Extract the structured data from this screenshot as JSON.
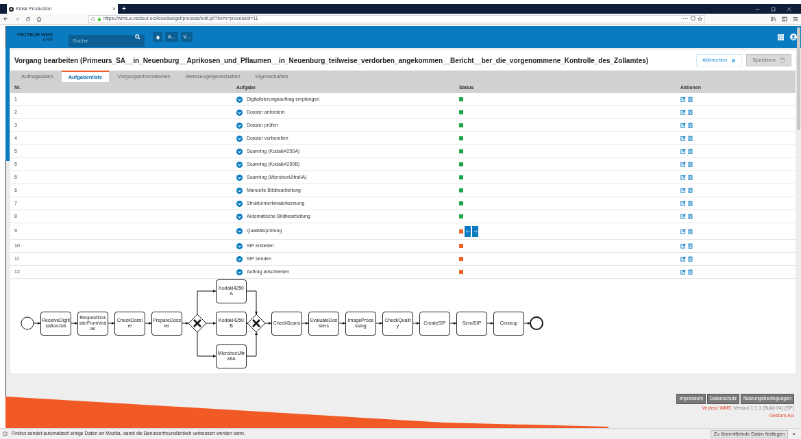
{
  "browser": {
    "tab_title": "Kiosk Production",
    "tab_close": "×",
    "new_tab": "+",
    "url": "https://wms.a.vecteur.ecl/kiosdesiget/process/edit.jsf?form=processid=11",
    "more": "···"
  },
  "app": {
    "logo_line1": "VECTEUR WMS",
    "logo_line2": "AHN",
    "search_placeholder": "Suche",
    "breadcrumbs": [
      "A...",
      "V..."
    ]
  },
  "title": "Vorgang bearbeiten (Primeurs_SA__in_Neuenburg__Aprikosen_und_Pflaumen__in_Neuenburg_teilweise_verdorben_angekommen__Bericht__ber_die_vorgenommene_Kontrolle_des_Zollamtes)",
  "buttons": [
    {
      "label": "Abbrechen",
      "disabled": false
    },
    {
      "label": "Speichern",
      "disabled": true
    }
  ],
  "tabs": [
    {
      "label": "Auftragsdaten",
      "selected": false
    },
    {
      "label": "Aufgabenliste",
      "selected": true
    },
    {
      "label": "Vorgangsinformationen",
      "selected": false
    },
    {
      "label": "Werkzeugeigenschaften",
      "selected": false
    },
    {
      "label": "Eigenschaften",
      "selected": false
    }
  ],
  "table": {
    "columns": [
      "Nr.",
      "Aufgabe",
      "Status",
      "Aktionen"
    ],
    "rows": [
      {
        "nr": "1",
        "task": "Digitalisierungsauftrag empfangen",
        "color": "#1fa64a",
        "current": false
      },
      {
        "nr": "2",
        "task": "Dossier anfordern",
        "color": "#1fa64a",
        "current": false
      },
      {
        "nr": "3",
        "task": "Dossier prüfen",
        "color": "#1fa64a",
        "current": false
      },
      {
        "nr": "4",
        "task": "Dossier vorbereiten",
        "color": "#1fa64a",
        "current": false
      },
      {
        "nr": "5",
        "task": "Scanning (Kodaki4250A)",
        "color": "#1fa64a",
        "current": false
      },
      {
        "nr": "5",
        "task": "Scanning (Kodaki4250B)",
        "color": "#1fa64a",
        "current": false
      },
      {
        "nr": "5",
        "task": "Scanning (MicroboxUltraIIA)",
        "color": "#1fa64a",
        "current": false
      },
      {
        "nr": "6",
        "task": "Manuelle Bildbearbeitung",
        "color": "#1fa64a",
        "current": false
      },
      {
        "nr": "7",
        "task": "Strukturmerkmalerkennung",
        "color": "#1fa64a",
        "current": false
      },
      {
        "nr": "8",
        "task": "Automatische Bildbearbeitung",
        "color": "#1fa64a",
        "current": false
      },
      {
        "nr": "9",
        "task": "Qualitätsprüfung",
        "color": "#f0622b",
        "current": true
      },
      {
        "nr": "10",
        "task": "SIP erstellen",
        "color": "#f0622b",
        "current": false
      },
      {
        "nr": "11",
        "task": "SIP senden",
        "color": "#f0622b",
        "current": false
      },
      {
        "nr": "12",
        "task": "Auftrag abschließen",
        "color": "#f0622b",
        "current": false
      }
    ]
  },
  "process": [
    {
      "kind": "start"
    },
    {
      "kind": "task",
      "label": "ReceiveDigitisationJob"
    },
    {
      "kind": "task",
      "label": "RequestDossierFromVodac"
    },
    {
      "kind": "task",
      "label": "CheckDossier"
    },
    {
      "kind": "task",
      "label": "PrepareDossier"
    },
    {
      "kind": "split",
      "branches": [
        {
          "kind": "task",
          "label": "Kodaki4250A"
        },
        {
          "kind": "task",
          "label": "Kodaki4250B"
        },
        {
          "kind": "task",
          "label": "MicroboxUltraIIA"
        }
      ]
    },
    {
      "kind": "task",
      "label": "CheckScans"
    },
    {
      "kind": "task",
      "label": "EvaluateDossiers"
    },
    {
      "kind": "task",
      "label": "ImageProcessing"
    },
    {
      "kind": "task",
      "label": "CheckQuality"
    },
    {
      "kind": "task",
      "label": "CreateSIP"
    },
    {
      "kind": "task",
      "label": "SendSIP"
    },
    {
      "kind": "task",
      "label": "Closeup"
    },
    {
      "kind": "end"
    }
  ],
  "footer": {
    "links": [
      "Impressum",
      "Datenschutz",
      "Nutzungsbedingungen"
    ],
    "product": "Vecteur WMS",
    "version": "Version 1.1.1 (Build 04) (SP)",
    "company": "Gestum AG"
  },
  "notification": {
    "text": "Firefox sendet automatisch einige Daten an Mozilla, damit die Benutzerfreundlichkeit verbessert werden kann.",
    "button": "Zu übermittelnde Daten festlegen",
    "close": "×"
  }
}
